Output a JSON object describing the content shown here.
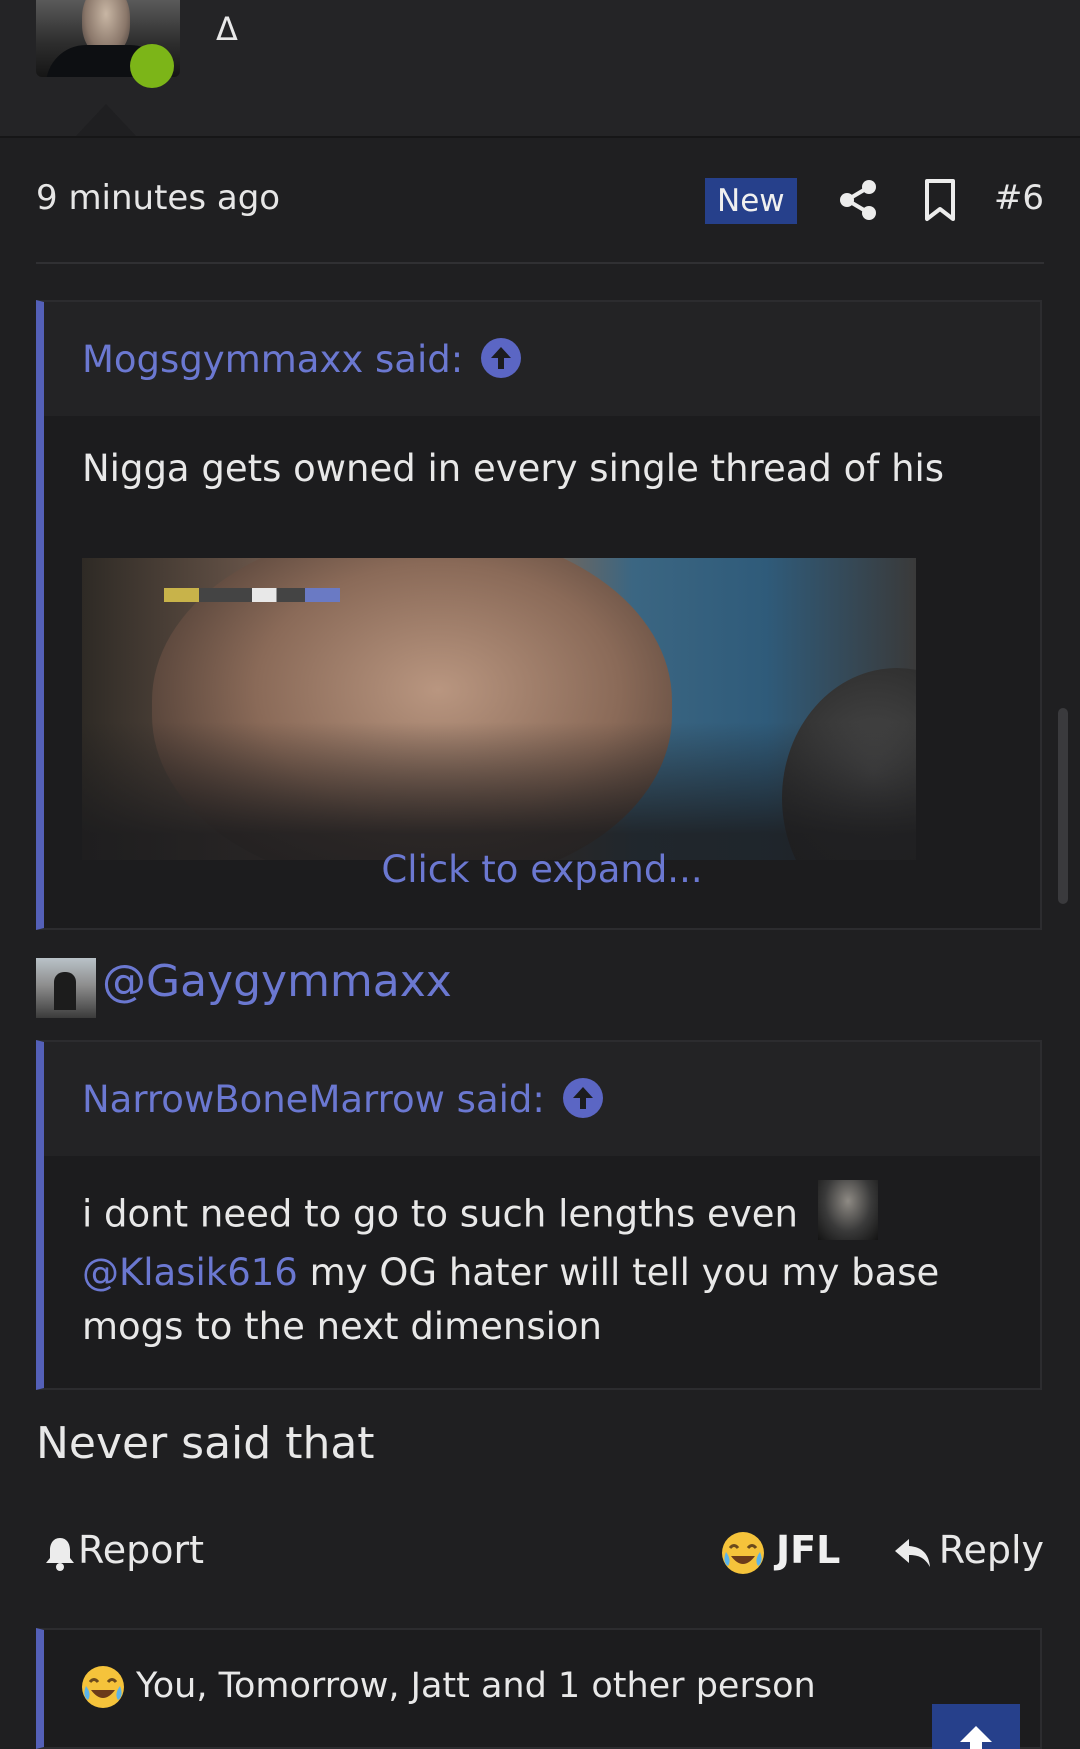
{
  "header": {
    "user_title": "Δ"
  },
  "post": {
    "time": "9 minutes ago",
    "badge": "New",
    "number": "#6"
  },
  "quote1": {
    "author": "Mogsgymmaxx said:",
    "text": "Nigga gets owned in every single thread of his",
    "expand": "Click to expand..."
  },
  "mention": {
    "text": "@Gaygymmaxx"
  },
  "quote2": {
    "author": "NarrowBoneMarrow said:",
    "text_before": "i dont need to go to such lengths even",
    "mention": "@Klasik616",
    "text_after": " my OG hater will tell you my base mogs to the next dimension"
  },
  "reply": {
    "text": "Never said that"
  },
  "actions": {
    "report": "Report",
    "jfl": "JFL",
    "reply": "Reply"
  },
  "reactions": {
    "text": "You, Tomorrow, Jatt and 1 other person"
  },
  "colors": {
    "accent": "#6b78d1",
    "badge": "#26408b",
    "online": "#7cb518",
    "background": "#1f1f21"
  }
}
